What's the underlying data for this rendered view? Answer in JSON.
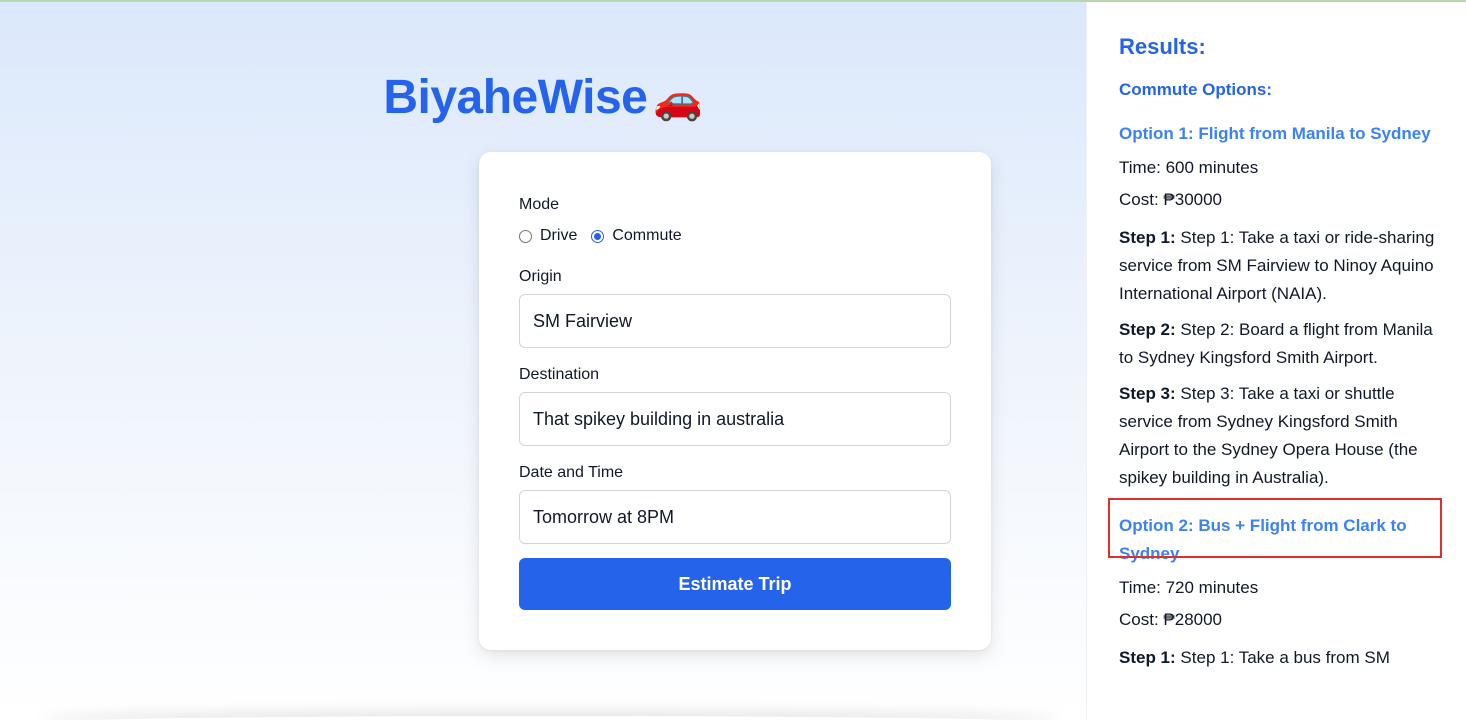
{
  "app": {
    "title": "BiyaheWise",
    "title_emoji": "🚗"
  },
  "form": {
    "mode_label": "Mode",
    "mode_options": [
      {
        "label": "Drive",
        "checked": false
      },
      {
        "label": "Commute",
        "checked": true
      }
    ],
    "origin_label": "Origin",
    "origin_value": "SM Fairview",
    "destination_label": "Destination",
    "destination_value": "That spikey building in australia",
    "datetime_label": "Date and Time",
    "datetime_value": "Tomorrow at 8PM",
    "submit_label": "Estimate Trip"
  },
  "results": {
    "title": "Results:",
    "subtitle": "Commute Options:",
    "options": [
      {
        "title": "Option 1: Flight from Manila to Sydney",
        "time": "Time: 600 minutes",
        "cost": "Cost: ₱30000",
        "steps": [
          {
            "label": "Step 1:",
            "text": "Step 1: Take a taxi or ride-sharing service from SM Fairview to Ninoy Aquino International Airport (NAIA)."
          },
          {
            "label": "Step 2:",
            "text": "Step 2: Board a flight from Manila to Sydney Kingsford Smith Airport."
          },
          {
            "label": "Step 3:",
            "text": "Step 3: Take a taxi or shuttle service from Sydney Kingsford Smith Airport to the Sydney Opera House (the spikey building in Australia)."
          }
        ]
      },
      {
        "title": "Option 2: Bus + Flight from Clark to Sydney",
        "time": "Time: 720 minutes",
        "cost": "Cost: ₱28000",
        "steps": [
          {
            "label": "Step 1:",
            "text": "Step 1: Take a bus from SM"
          }
        ]
      }
    ]
  },
  "colors": {
    "accent": "#2563eb",
    "option_title": "#3b82f6",
    "highlight_box": "#e0302a"
  }
}
